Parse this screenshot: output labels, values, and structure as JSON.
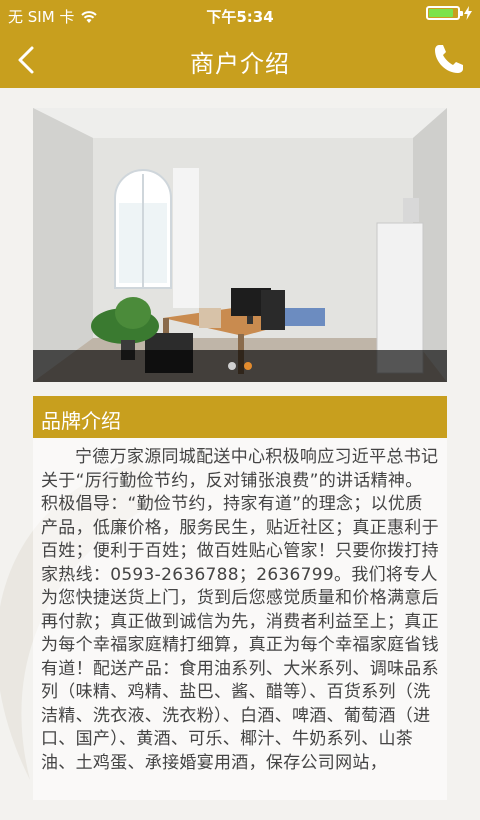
{
  "status_bar": {
    "carrier": "无 SIM 卡",
    "time": "下午5:34",
    "battery_level": 0.85,
    "icons": [
      "wifi-icon",
      "battery-icon",
      "charging-bolt-icon"
    ]
  },
  "nav": {
    "title": "商户介绍",
    "back_icon": "chevron-left-icon",
    "call_icon": "phone-icon"
  },
  "carousel": {
    "slide_count": 2,
    "active_index": 1
  },
  "brand_section": {
    "title": "品牌介绍",
    "body": "宁德万家源同城配送中心积极响应习近平总书记关于“厉行勤俭节约，反对铺张浪费”的讲话精神。积极倡导：“勤俭节约，持家有道”的理念；以优质产品，低廉价格，服务民生，贴近社区；真正惠利于百姓；便利于百姓；做百姓贴心管家！只要你拨打持家热线：0593-2636788；2636799。我们将专人为您快捷送货上门，货到后您感觉质量和价格满意后再付款；真正做到诚信为先，消费者利益至上；真正为每个幸福家庭精打细算，真正为每个幸福家庭省钱有道！配送产品：食用油系列、大米系列、调味品系列（味精、鸡精、盐巴、酱、醋等）、百货系列（洗洁精、洗衣液、洗衣粉）、白酒、啤酒、葡萄酒（进口、国产）、黄酒、可乐、椰汁、牛奶系列、山茶油、土鸡蛋、承接婚宴用酒，保存公司网站，"
  },
  "colors": {
    "brand": "#c89f1e",
    "background": "#f3f2ef",
    "dot_active": "#e38b2d",
    "dot_inactive": "#cfcfcf"
  }
}
